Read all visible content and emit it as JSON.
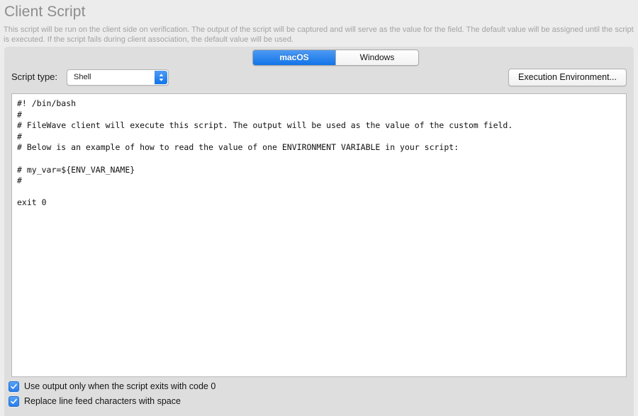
{
  "header": {
    "title": "Client Script",
    "description": "This script will be run on the client side on verification. The output of the script will be captured and will serve as the value for the field. The default value will be assigned until the script is executed. If the script fails during client association, the default value will be used."
  },
  "tabs": [
    {
      "label": "macOS",
      "selected": true
    },
    {
      "label": "Windows",
      "selected": false
    }
  ],
  "toolbar": {
    "script_type_label": "Script type:",
    "script_type_value": "Shell",
    "script_type_options": [
      "Shell"
    ],
    "execution_environment_label": "Execution Environment...",
    "stepper_icon": "chevron-up-down-icon"
  },
  "editor": {
    "content": "#! /bin/bash\n#\n# FileWave client will execute this script. The output will be used as the value of the custom field.\n#\n# Below is an example of how to read the value of one ENVIRONMENT VARIABLE in your script:\n\n# my_var=${ENV_VAR_NAME}\n#\n\nexit 0"
  },
  "options": [
    {
      "label": "Use output only when the script exits with code 0",
      "checked": true
    },
    {
      "label": "Replace line feed characters with space",
      "checked": true
    }
  ],
  "colors": {
    "accent_blue": "#1274e8",
    "page_background": "#ececec",
    "panel_background": "#dedede",
    "editor_background": "#ffffff",
    "title_text": "#8c8c8c",
    "description_text": "#a3a3a3"
  }
}
